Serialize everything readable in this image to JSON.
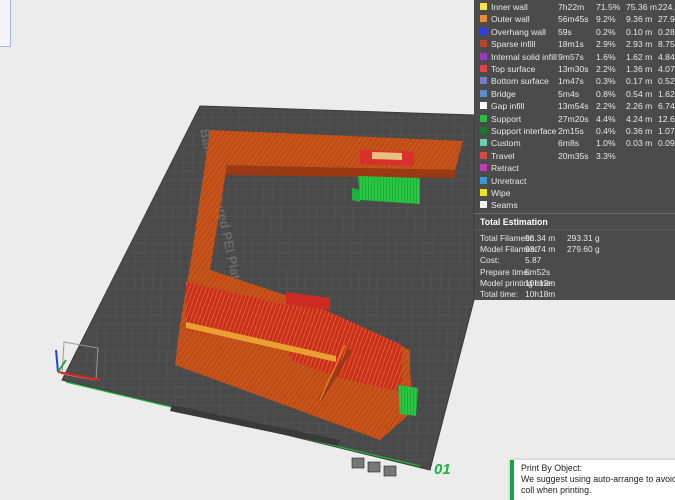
{
  "legend": {
    "rows": [
      {
        "name": "Inner wall",
        "time": "7h22m",
        "pct": "71.5%",
        "length": "75.36 m",
        "weight": "224.",
        "color": "#ffe24a"
      },
      {
        "name": "Outer wall",
        "time": "56m45s",
        "pct": "9.2%",
        "length": "9.36 m",
        "weight": "27.9",
        "color": "#f08a2a"
      },
      {
        "name": "Overhang wall",
        "time": "59s",
        "pct": "0.2%",
        "length": "0.10 m",
        "weight": "0.28",
        "color": "#2a3cf0"
      },
      {
        "name": "Sparse infill",
        "time": "18m1s",
        "pct": "2.9%",
        "length": "2.93 m",
        "weight": "8.75",
        "color": "#b8432a"
      },
      {
        "name": "Internal solid infill",
        "time": "9m57s",
        "pct": "1.6%",
        "length": "1.62 m",
        "weight": "4.84",
        "color": "#9a3ac0"
      },
      {
        "name": "Top surface",
        "time": "13m30s",
        "pct": "2.2%",
        "length": "1.36 m",
        "weight": "4.07",
        "color": "#e8404a"
      },
      {
        "name": "Bottom surface",
        "time": "1m47s",
        "pct": "0.3%",
        "length": "0.17 m",
        "weight": "0.52",
        "color": "#7a7ad0"
      },
      {
        "name": "Bridge",
        "time": "5m4s",
        "pct": "0.8%",
        "length": "0.54 m",
        "weight": "1.62",
        "color": "#5a8ad0"
      },
      {
        "name": "Gap infill",
        "time": "13m54s",
        "pct": "2.2%",
        "length": "2.26 m",
        "weight": "6.74",
        "color": "#ffffff"
      },
      {
        "name": "Support",
        "time": "27m20s",
        "pct": "4.4%",
        "length": "4.24 m",
        "weight": "12.6",
        "color": "#22c03a"
      },
      {
        "name": "Support interface",
        "time": "2m15s",
        "pct": "0.4%",
        "length": "0.36 m",
        "weight": "1.07",
        "color": "#1a7a2a"
      },
      {
        "name": "Custom",
        "time": "6m8s",
        "pct": "1.0%",
        "length": "0.03 m",
        "weight": "0.09",
        "color": "#6ad0b0"
      },
      {
        "name": "Travel",
        "time": "20m35s",
        "pct": "3.3%",
        "length": "",
        "weight": "",
        "color": "#d04a4a"
      },
      {
        "name": "Retract",
        "time": "",
        "pct": "",
        "length": "",
        "weight": "",
        "color": "#c43ab8"
      },
      {
        "name": "Unretract",
        "time": "",
        "pct": "",
        "length": "",
        "weight": "",
        "color": "#3a9ad8"
      },
      {
        "name": "Wipe",
        "time": "",
        "pct": "",
        "length": "",
        "weight": "",
        "color": "#f0e020"
      },
      {
        "name": "Seams",
        "time": "",
        "pct": "",
        "length": "",
        "weight": "",
        "color": "#f0f0f0"
      }
    ],
    "total_title": "Total Estimation",
    "totals": [
      {
        "label": "Total Filament:",
        "v1": "98.34 m",
        "v2": "293.31 g"
      },
      {
        "label": "Model Filament:",
        "v1": "93.74 m",
        "v2": "279.60 g"
      },
      {
        "label": "Cost:",
        "v1": "5.87",
        "v2": ""
      },
      {
        "label": "Prepare time:",
        "v1": "5m52s",
        "v2": ""
      },
      {
        "label": "Model printing time:",
        "v1": "10h12m",
        "v2": ""
      },
      {
        "label": "Total time:",
        "v1": "10h18m",
        "v2": ""
      }
    ]
  },
  "plate": {
    "label": "Bambu Textured PEI Plate",
    "number": "01"
  },
  "notification": {
    "title": "Print By Object:",
    "message": "We suggest using auto-arrange to avoid coll when printing."
  },
  "colors": {
    "plate": "#4a4a4a",
    "grid": "#5e5e5e",
    "model": "#c8541a",
    "top": "#e03a3a",
    "support": "#22c03a",
    "accent": "#18a34a"
  }
}
